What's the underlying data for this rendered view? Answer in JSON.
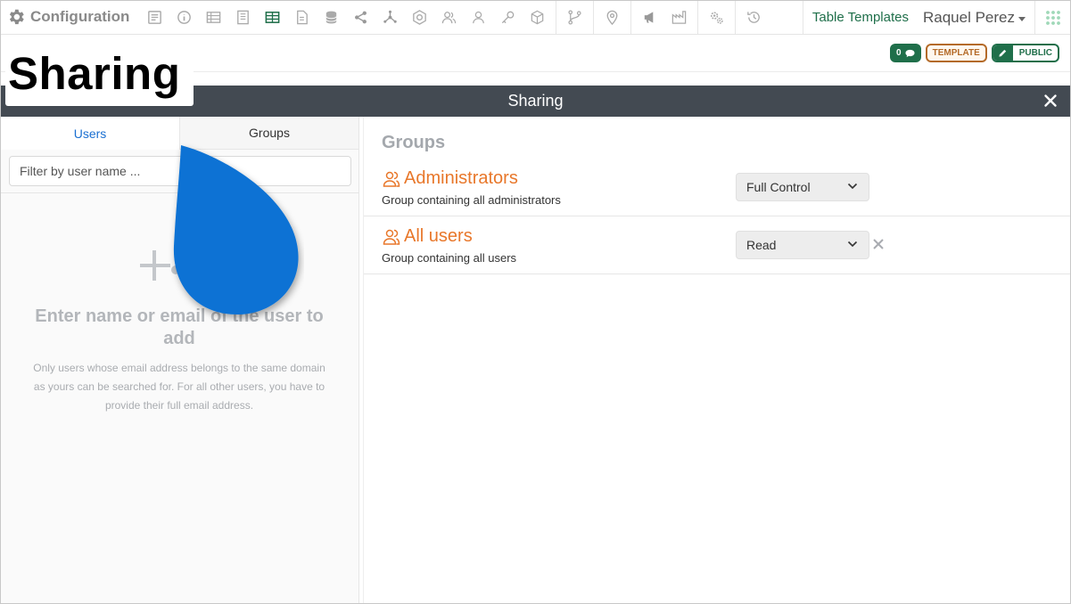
{
  "app": {
    "title": "Configuration"
  },
  "toolbar": {
    "icons": [
      "form-icon",
      "info-icon",
      "table-list-icon",
      "document-list-icon",
      "table-icon",
      "file-icon",
      "database-icon",
      "share-nodes-icon",
      "network-icon",
      "hexagon-icon",
      "users-icon",
      "user-icon",
      "key-icon",
      "cube-icon",
      "branch-icon",
      "map-pin-icon",
      "megaphone-icon",
      "factory-icon",
      "gears-icon",
      "history-icon"
    ],
    "table_templates": "Table Templates",
    "user_name": "Raquel Perez"
  },
  "header": {
    "page_title": "Sharing",
    "comment_count": "0",
    "template_badge": "TEMPLATE",
    "public_badge": "PUBLIC"
  },
  "modal": {
    "title": "Sharing",
    "tabs": {
      "users": "Users",
      "groups": "Groups"
    },
    "filter_placeholder": "Filter by user name ...",
    "empty_title": "Enter name or email of the user to add",
    "empty_desc": "Only users whose email address belongs to the same domain as yours can be searched for. For all other users, you have to provide their full email address.",
    "groups_heading": "Groups",
    "groups": [
      {
        "name": "Administrators",
        "desc": "Group containing all administrators",
        "permission": "Full Control"
      },
      {
        "name": "All users",
        "desc": "Group containing all users",
        "permission": "Read"
      }
    ]
  },
  "colors": {
    "brand_green": "#1f6f4a",
    "modal_bar": "#434a52",
    "group_orange": "#e8772a",
    "tab_active_blue": "#1a6fd1",
    "blob_blue": "#0a72d4",
    "template_brown": "#b46a28"
  }
}
